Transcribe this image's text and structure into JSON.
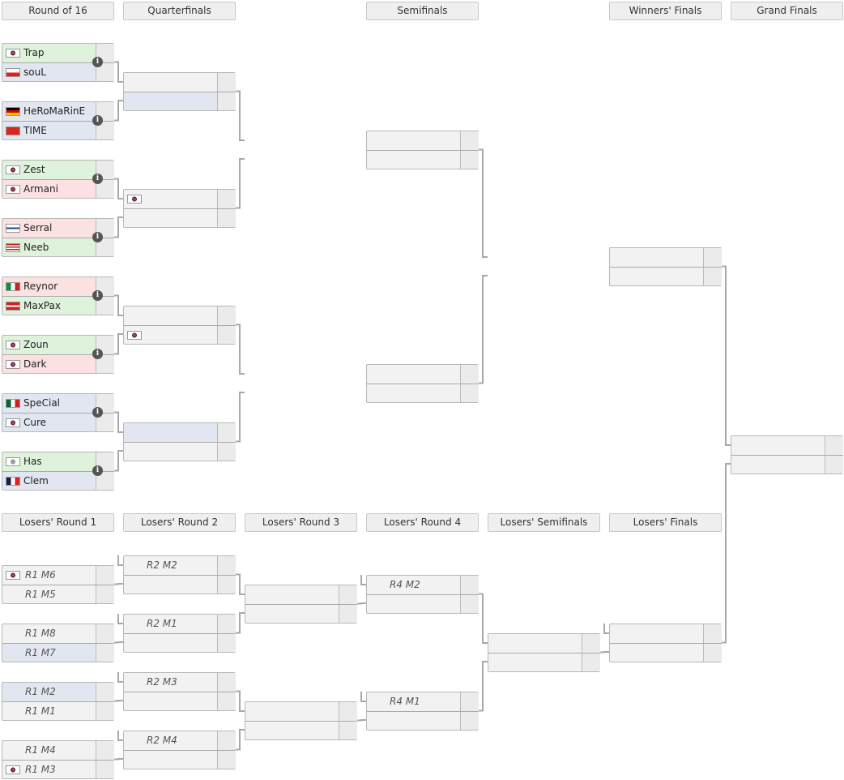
{
  "headers": {
    "upper": [
      "Round of 16",
      "Quarterfinals",
      "Semifinals",
      "Winners' Finals",
      "Grand Finals"
    ],
    "lower": [
      "Losers' Round 1",
      "Losers' Round 2",
      "Losers' Round 3",
      "Losers' Round 4",
      "Losers' Semifinals",
      "Losers' Finals"
    ]
  },
  "colors": {
    "win": "#dff2dc",
    "lose": "#fbe1e1",
    "pending": "#e1e6f0",
    "empty": "#f2f2f2"
  },
  "upper": {
    "round_of_16": [
      [
        {
          "name": "Trap",
          "flag": "kr",
          "state": "win"
        },
        {
          "name": "souL",
          "flag": "pl",
          "state": "blue"
        }
      ],
      [
        {
          "name": "HeRoMaRinE",
          "flag": "de",
          "state": "blue"
        },
        {
          "name": "TIME",
          "flag": "cn",
          "state": "blue"
        }
      ],
      [
        {
          "name": "Zest",
          "flag": "kr",
          "state": "win"
        },
        {
          "name": "Armani",
          "flag": "kr",
          "state": "lose"
        }
      ],
      [
        {
          "name": "Serral",
          "flag": "fi",
          "state": "lose"
        },
        {
          "name": "Neeb",
          "flag": "us",
          "state": "win"
        }
      ],
      [
        {
          "name": "Reynor",
          "flag": "it",
          "state": "lose"
        },
        {
          "name": "MaxPax",
          "flag": "dk",
          "state": "win"
        }
      ],
      [
        {
          "name": "Zoun",
          "flag": "kr",
          "state": "win"
        },
        {
          "name": "Dark",
          "flag": "kr",
          "state": "lose"
        }
      ],
      [
        {
          "name": "SpeCial",
          "flag": "mx",
          "state": "blue"
        },
        {
          "name": "Cure",
          "flag": "kr",
          "state": "blue"
        }
      ],
      [
        {
          "name": "Has",
          "flag": "other",
          "state": "win"
        },
        {
          "name": "Clem",
          "flag": "fr",
          "state": "blue"
        }
      ]
    ],
    "quarterfinals": [
      [
        {
          "name": "",
          "state": ""
        },
        {
          "name": "",
          "state": "blue"
        }
      ],
      [
        {
          "name": "",
          "flag": "kr",
          "state": ""
        },
        {
          "name": "",
          "state": ""
        }
      ],
      [
        {
          "name": "",
          "state": ""
        },
        {
          "name": "",
          "flag": "kr",
          "state": ""
        }
      ],
      [
        {
          "name": "",
          "state": "blue"
        },
        {
          "name": "",
          "state": ""
        }
      ]
    ],
    "semifinals": [
      [
        {},
        {}
      ],
      [
        {},
        {}
      ]
    ],
    "winners_finals": [
      [
        {},
        {}
      ]
    ],
    "grand_finals": [
      [
        {},
        {}
      ]
    ]
  },
  "info_icon": "info-icon",
  "lower": {
    "round1": [
      [
        {
          "name": "R1 M6",
          "flag": "kr"
        },
        {
          "name": "R1 M5"
        }
      ],
      [
        {
          "name": "R1 M8"
        },
        {
          "name": "R1 M7",
          "state": "blue"
        }
      ],
      [
        {
          "name": "R1 M2",
          "state": "blue"
        },
        {
          "name": "R1 M1"
        }
      ],
      [
        {
          "name": "R1 M4"
        },
        {
          "name": "R1 M3",
          "flag": "kr"
        }
      ]
    ],
    "round2": [
      [
        {
          "name": "R2 M2"
        },
        {}
      ],
      [
        {
          "name": "R2 M1"
        },
        {}
      ],
      [
        {
          "name": "R2 M3"
        },
        {}
      ],
      [
        {
          "name": "R2 M4"
        },
        {}
      ]
    ],
    "round3": [
      [
        {},
        {}
      ],
      [
        {},
        {}
      ]
    ],
    "round4": [
      [
        {
          "name": "R4 M2"
        },
        {}
      ],
      [
        {
          "name": "R4 M1"
        },
        {}
      ]
    ],
    "semifinals": [
      [
        {},
        {}
      ]
    ],
    "finals": [
      [
        {},
        {}
      ]
    ]
  }
}
